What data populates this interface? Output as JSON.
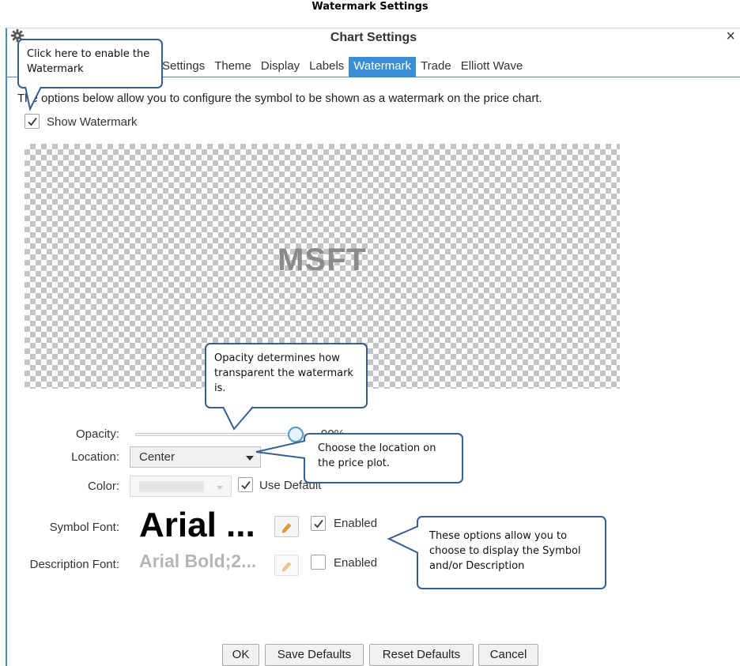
{
  "page_title": "Watermark Settings",
  "window": {
    "title": "Chart Settings",
    "close_glyph": "×",
    "gear_icon": "gear-icon"
  },
  "tabs": [
    {
      "label": "Settings",
      "active": false
    },
    {
      "label": "Theme",
      "active": false
    },
    {
      "label": "Display",
      "active": false
    },
    {
      "label": "Labels",
      "active": false
    },
    {
      "label": "Watermark",
      "active": true
    },
    {
      "label": "Trade",
      "active": false
    },
    {
      "label": "Elliott Wave",
      "active": false
    }
  ],
  "description": "The options below allow you to configure the symbol to be shown as a watermark on the price chart.",
  "show_watermark": {
    "label": "Show Watermark",
    "checked": true
  },
  "preview": {
    "text": "MSFT"
  },
  "opacity": {
    "label": "Opacity:",
    "value_text": "90%",
    "value": 0.9
  },
  "location": {
    "label": "Location:",
    "value": "Center"
  },
  "color": {
    "label": "Color:",
    "use_default_label": "Use Default",
    "use_default_checked": true
  },
  "symbol_font": {
    "label": "Symbol Font:",
    "sample": "Arial ...",
    "enabled_label": "Enabled",
    "enabled": true
  },
  "description_font": {
    "label": "Description Font:",
    "sample": "Arial Bold;2...",
    "enabled_label": "Enabled",
    "enabled": false
  },
  "buttons": {
    "ok": "OK",
    "save_defaults": "Save Defaults",
    "reset_defaults": "Reset Defaults",
    "cancel": "Cancel"
  },
  "callouts": {
    "enable": "Click here to enable the Watermark",
    "opacity": "Opacity determines how transparent the watermark is.",
    "location": "Choose the location on the price plot.",
    "options": "These options allow you to choose to display the Symbol and/or Description"
  },
  "colors": {
    "accent": "#3a8ed3",
    "callout_border": "#365f91",
    "slider_thumb": "#4a9ad8",
    "edit_icon": "#f0a030"
  }
}
